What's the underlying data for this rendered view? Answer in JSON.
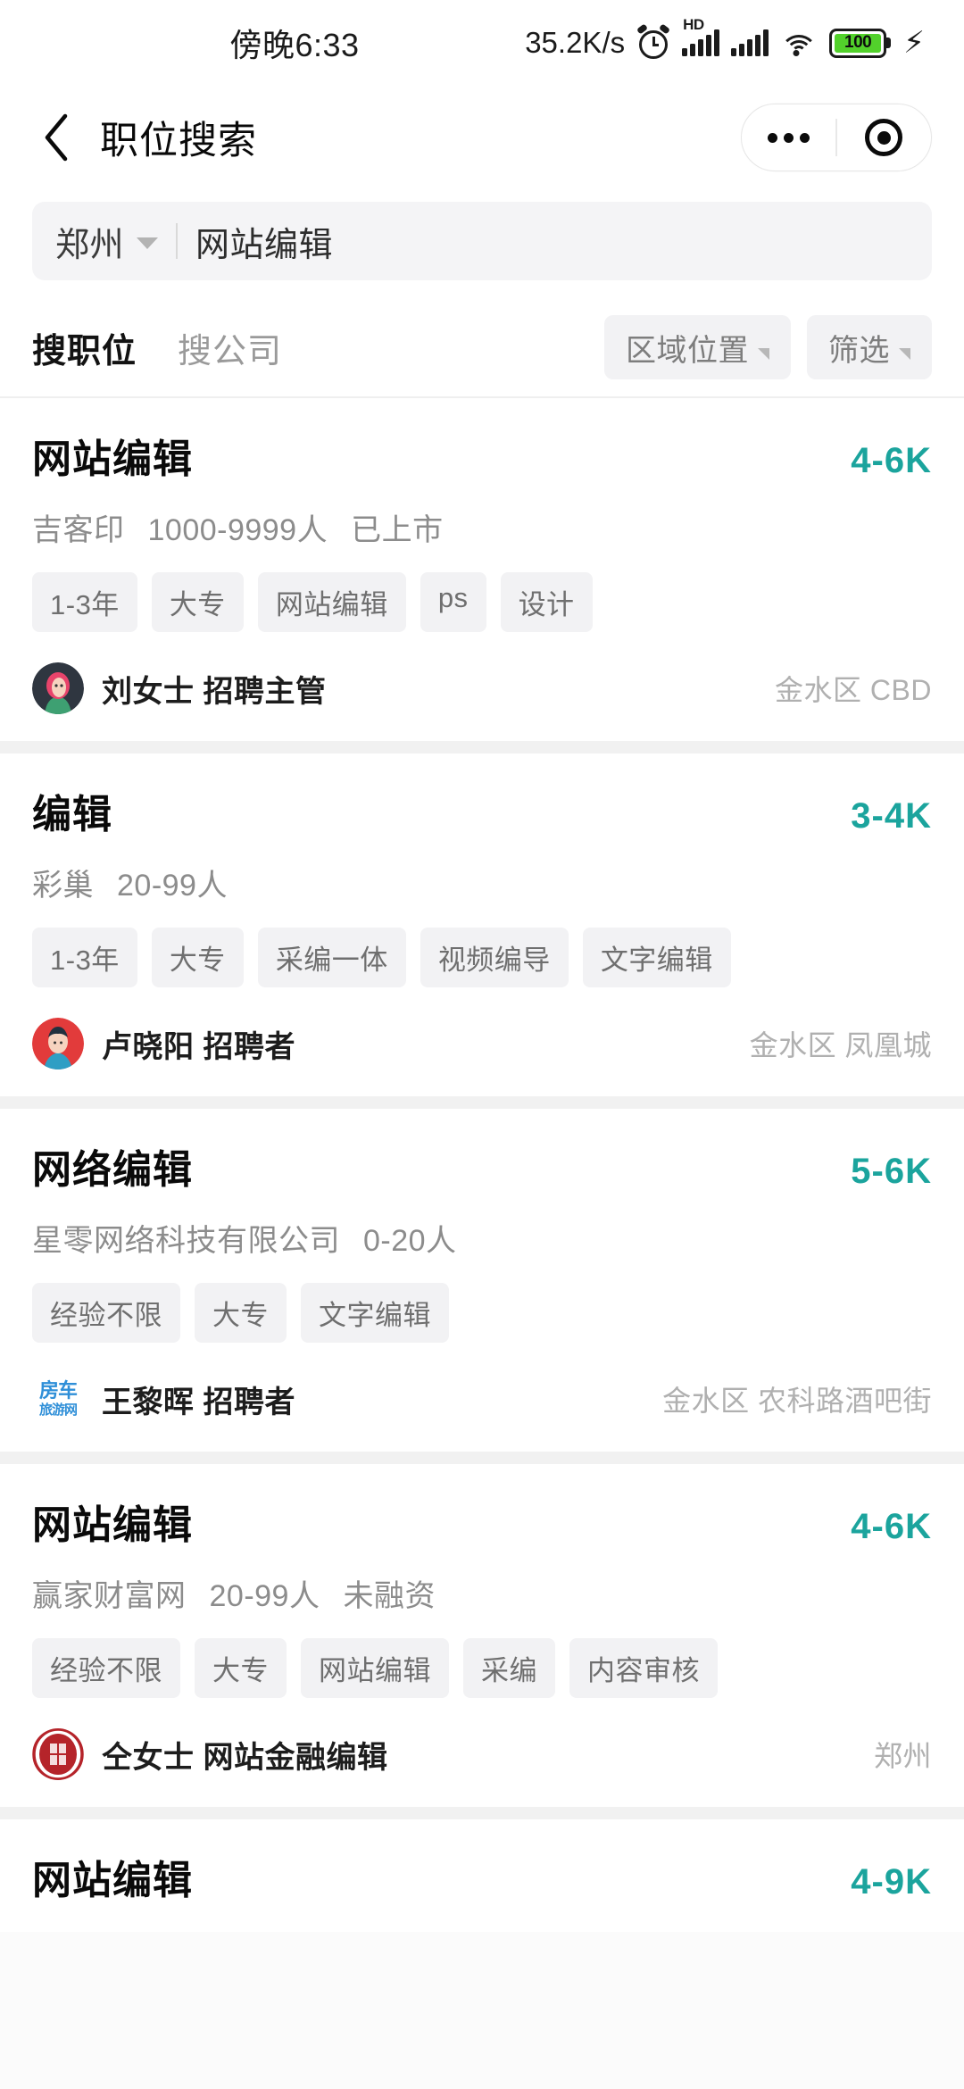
{
  "statusbar": {
    "time": "傍晚6:33",
    "network_speed": "35.2K/s",
    "alarm_icon": "alarm-clock-icon",
    "hd_label": "HD",
    "signal_icon": "signal-bars-icon",
    "signal2_icon": "signal-bars-icon",
    "wifi_icon": "wifi-icon",
    "battery_percent": "100",
    "charging_icon": "lightning-bolt-icon"
  },
  "navbar": {
    "back_icon": "back-chevron-icon",
    "title": "职位搜索",
    "more_icon": "more-dots-icon",
    "capsule_icon": "target-circle-icon"
  },
  "search": {
    "city": "郑州",
    "city_caret_icon": "chevron-down-icon",
    "query": "网站编辑"
  },
  "tabs": {
    "items": [
      {
        "label": "搜职位",
        "active": true
      },
      {
        "label": "搜公司",
        "active": false
      }
    ],
    "filters": [
      {
        "label": "区域位置",
        "icon": "filter-caret-icon"
      },
      {
        "label": "筛选",
        "icon": "filter-caret-icon"
      }
    ]
  },
  "colors": {
    "salary": "#1ba49d",
    "page_bg": "#f1f1f1",
    "card_bg": "#ffffff",
    "tag_bg": "#f2f2f4",
    "battery_fill": "#52d12b"
  },
  "jobs": [
    {
      "title": "网站编辑",
      "salary": "4-6K",
      "company": "吉客印",
      "size": "1000-9999人",
      "stage": "已上市",
      "tags": [
        "1-3年",
        "大专",
        "网站编辑",
        "ps",
        "设计"
      ],
      "recruiter": "刘女士 招聘主管",
      "location": "金水区 CBD",
      "avatar_type": "photo-female",
      "avatar_name": "recruiter-avatar"
    },
    {
      "title": "编辑",
      "salary": "3-4K",
      "company": "彩巢",
      "size": "20-99人",
      "stage": "",
      "tags": [
        "1-3年",
        "大专",
        "采编一体",
        "视频编导",
        "文字编辑"
      ],
      "recruiter": "卢晓阳 招聘者",
      "location": "金水区 凤凰城",
      "avatar_type": "photo-male",
      "avatar_name": "recruiter-avatar"
    },
    {
      "title": "网络编辑",
      "salary": "5-6K",
      "company": "星零网络科技有限公司",
      "size": "0-20人",
      "stage": "",
      "tags": [
        "经验不限",
        "大专",
        "文字编辑"
      ],
      "recruiter": "王黎晖 招聘者",
      "location": "金水区 农科路酒吧街",
      "avatar_type": "logo-fangche",
      "avatar_name": "company-logo",
      "logo_line1": "房车",
      "logo_line2": "旅游网"
    },
    {
      "title": "网站编辑",
      "salary": "4-6K",
      "company": "赢家财富网",
      "size": "20-99人",
      "stage": "未融资",
      "tags": [
        "经验不限",
        "大专",
        "网站编辑",
        "采编",
        "内容审核"
      ],
      "recruiter": "仝女士 网站金融编辑",
      "location": "郑州",
      "avatar_type": "logo-seal",
      "avatar_name": "company-logo"
    },
    {
      "title": "网站编辑",
      "salary": "4-9K",
      "company": "",
      "size": "",
      "stage": "",
      "tags": [],
      "recruiter": "",
      "location": "",
      "avatar_type": "none",
      "avatar_name": "none"
    }
  ]
}
